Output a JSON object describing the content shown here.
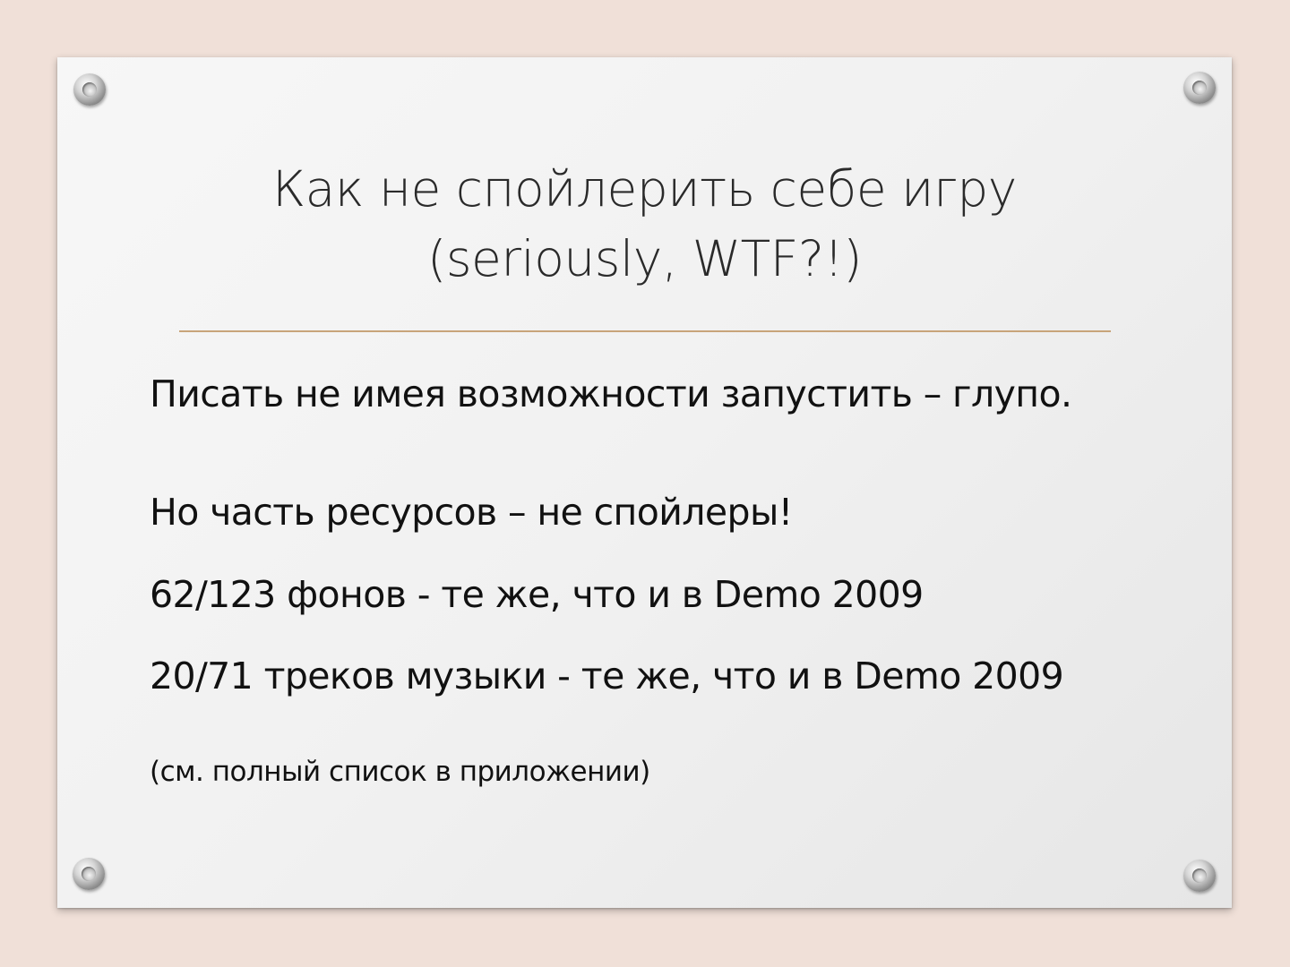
{
  "slide": {
    "title_line1": "Как не спойлерить себе игру",
    "title_line2": "(seriously, WTF?!)",
    "lines": [
      "Писать не имея возможности запустить – глупо.",
      "Но часть ресурсов – не спойлеры!",
      "62/123 фонов - те же, что и в Demo 2009",
      "20/71 треков музыки - те же, что и в Demo 2009",
      "(см. полный список в приложении)"
    ]
  },
  "colors": {
    "background": "#f0e0d8",
    "plate": "#f2f2f2",
    "divider": "#c8a47a",
    "text": "#111111"
  },
  "icons": [
    "screw-icon"
  ]
}
